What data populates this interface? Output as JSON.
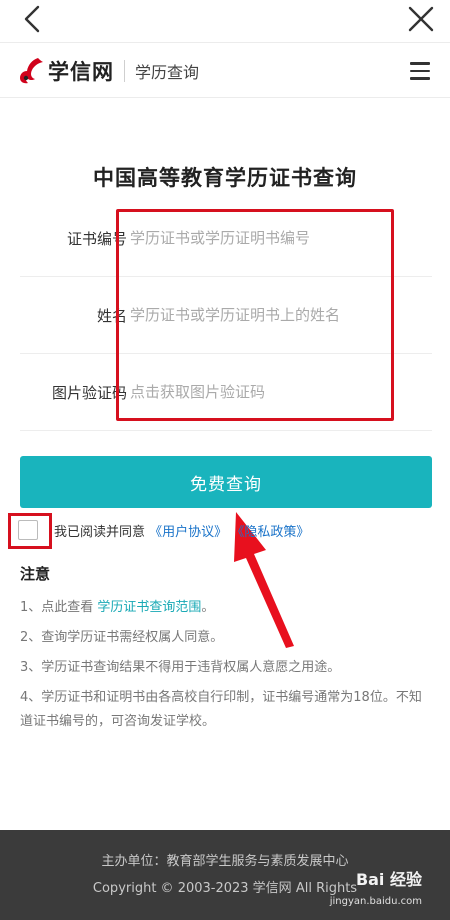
{
  "site": {
    "logo_text": "学信网",
    "logo_sub": "学历查询"
  },
  "page_title": "中国高等教育学历证书查询",
  "form": {
    "fields": [
      {
        "label": "证书编号",
        "placeholder": "学历证书或学历证明书编号"
      },
      {
        "label": "姓名",
        "placeholder": "学历证书或学历证明书上的姓名"
      },
      {
        "label": "图片验证码",
        "placeholder": "点击获取图片验证码"
      }
    ],
    "submit_label": "免费查询"
  },
  "agreement": {
    "prefix": "我已阅读并同意",
    "user_agreement": "《用户协议》",
    "privacy_policy": "《隐私政策》"
  },
  "notes": {
    "heading": "注意",
    "items": [
      {
        "text": "1、点此查看",
        "link": " 学历证书查询范围",
        "suffix": "。"
      },
      {
        "text": "2、查询学历证书需经权属人同意。"
      },
      {
        "text": "3、学历证书查询结果不得用于违背权属人意愿之用途。"
      },
      {
        "text": "4、学历证书和证明书由各高校自行印制，证书编号通常为18位。不知道证书编号的，可咨询发证学校。"
      }
    ]
  },
  "footer": {
    "line1": "主办单位：教育部学生服务与素质发展中心",
    "line2": "Copyright © 2003-2023 学信网 All Rights"
  },
  "watermark": {
    "text": "Bai 经验",
    "sub": "jingyan.baidu.com"
  },
  "colors": {
    "accent": "#19b4bd",
    "link": "#1a73c9",
    "annotation": "#d6101e",
    "footer_bg": "#3b3b3b"
  }
}
